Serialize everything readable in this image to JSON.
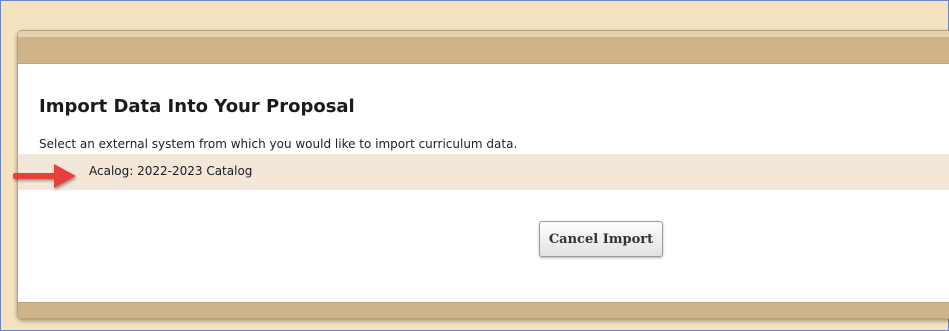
{
  "dialog": {
    "title": "Import Data Into Your Proposal",
    "instructions": "Select an external system from which you would like to import curriculum data.",
    "sources": [
      {
        "label": "Acalog: 2022-2023 Catalog"
      }
    ],
    "cancel_label": "Cancel Import"
  },
  "annotation": {
    "arrow_icon": "red-arrow-right-icon",
    "arrow_color": "#e8413b"
  },
  "colors": {
    "page_background": "#f5e2bf",
    "header_footer": "#cfb489",
    "source_row": "#f2e7d8"
  }
}
